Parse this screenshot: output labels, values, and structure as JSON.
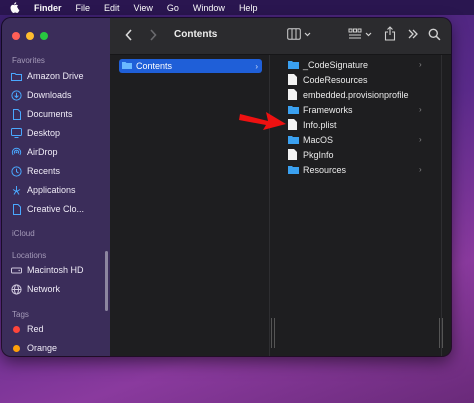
{
  "menubar": {
    "items": [
      "Finder",
      "File",
      "Edit",
      "View",
      "Go",
      "Window",
      "Help"
    ]
  },
  "toolbar": {
    "title": "Contents",
    "icons": [
      "back-icon",
      "forward-icon",
      "column-view-icon",
      "group-icon",
      "share-icon",
      "more-icon",
      "search-icon"
    ]
  },
  "sidebar": {
    "favorites_label": "Favorites",
    "favorites": [
      {
        "label": "Amazon Drive",
        "icon": "folder-icon"
      },
      {
        "label": "Downloads",
        "icon": "download-icon"
      },
      {
        "label": "Documents",
        "icon": "document-icon"
      },
      {
        "label": "Desktop",
        "icon": "desktop-icon"
      },
      {
        "label": "AirDrop",
        "icon": "airdrop-icon"
      },
      {
        "label": "Recents",
        "icon": "clock-icon"
      },
      {
        "label": "Applications",
        "icon": "applications-icon"
      },
      {
        "label": "Creative Clo...",
        "icon": "file-icon"
      }
    ],
    "icloud_label": "iCloud",
    "locations_label": "Locations",
    "locations": [
      {
        "label": "Macintosh HD",
        "icon": "disk-icon"
      },
      {
        "label": "Network",
        "icon": "globe-icon"
      }
    ],
    "tags_label": "Tags",
    "tags": [
      {
        "label": "Red",
        "color": "#ff453a"
      },
      {
        "label": "Orange",
        "color": "#ff9f0a"
      }
    ]
  },
  "column1": {
    "selected": "Contents"
  },
  "column2": {
    "items": [
      {
        "label": "_CodeSignature",
        "kind": "folder",
        "has_children": true
      },
      {
        "label": "CodeResources",
        "kind": "file",
        "has_children": false
      },
      {
        "label": "embedded.provisionprofile",
        "kind": "file",
        "has_children": false
      },
      {
        "label": "Frameworks",
        "kind": "folder",
        "has_children": true
      },
      {
        "label": "Info.plist",
        "kind": "file",
        "has_children": false
      },
      {
        "label": "MacOS",
        "kind": "folder",
        "has_children": true
      },
      {
        "label": "PkgInfo",
        "kind": "file",
        "has_children": false
      },
      {
        "label": "Resources",
        "kind": "folder",
        "has_children": true
      }
    ]
  },
  "colors": {
    "accent": "#1f5fd8",
    "folder": "#3aa0f0",
    "annotation_arrow": "#ee1111",
    "traffic_close": "#ff5f57",
    "traffic_min": "#febc2e",
    "traffic_max": "#28c840"
  }
}
